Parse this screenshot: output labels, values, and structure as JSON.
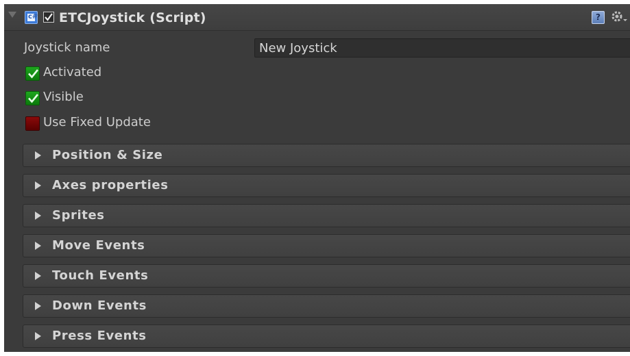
{
  "header": {
    "title": "ETCJoystick (Script)",
    "enabled": true,
    "icons": [
      "c#-script-icon",
      "help-icon",
      "gear-icon"
    ]
  },
  "properties": {
    "joystick_name_label": "Joystick name",
    "joystick_name_value": "New Joystick",
    "activated_label": "Activated",
    "activated": true,
    "visible_label": "Visible",
    "visible": true,
    "use_fixed_update_label": "Use Fixed Update",
    "use_fixed_update": false
  },
  "sections": [
    {
      "label": "Position & Size"
    },
    {
      "label": "Axes properties"
    },
    {
      "label": "Sprites"
    },
    {
      "label": "Move Events"
    },
    {
      "label": "Touch Events"
    },
    {
      "label": "Down Events"
    },
    {
      "label": "Press Events"
    }
  ],
  "colors": {
    "panel_bg": "#3b3b3b",
    "checkbox_on": "#1a961a",
    "checkbox_off": "#7a0000",
    "text": "#cdcdcd"
  }
}
